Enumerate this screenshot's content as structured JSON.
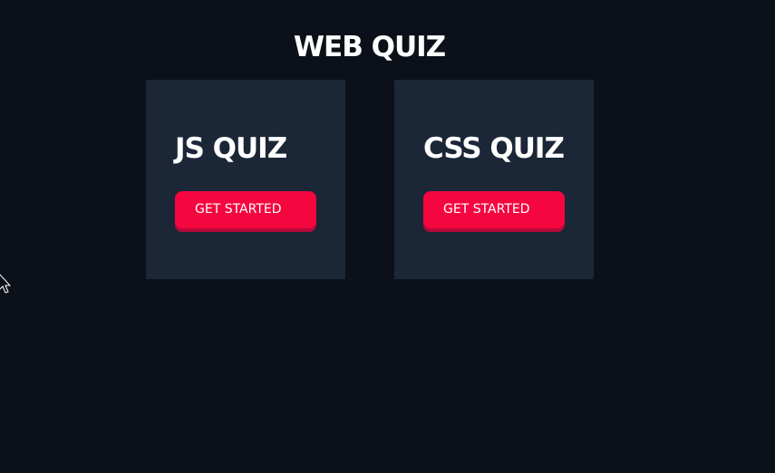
{
  "page": {
    "title": "WEB QUIZ"
  },
  "cards": [
    {
      "title": "JS QUIZ",
      "button_label": "GET STARTED"
    },
    {
      "title": "CSS QUIZ",
      "button_label": "GET STARTED"
    }
  ],
  "colors": {
    "background": "#0c1119",
    "card": "#1b2637",
    "accent": "#f5063f",
    "accent_shadow": "#b70a3a",
    "text": "#ffffff"
  },
  "icons": {
    "cursor": "mouse-pointer-arrow"
  }
}
